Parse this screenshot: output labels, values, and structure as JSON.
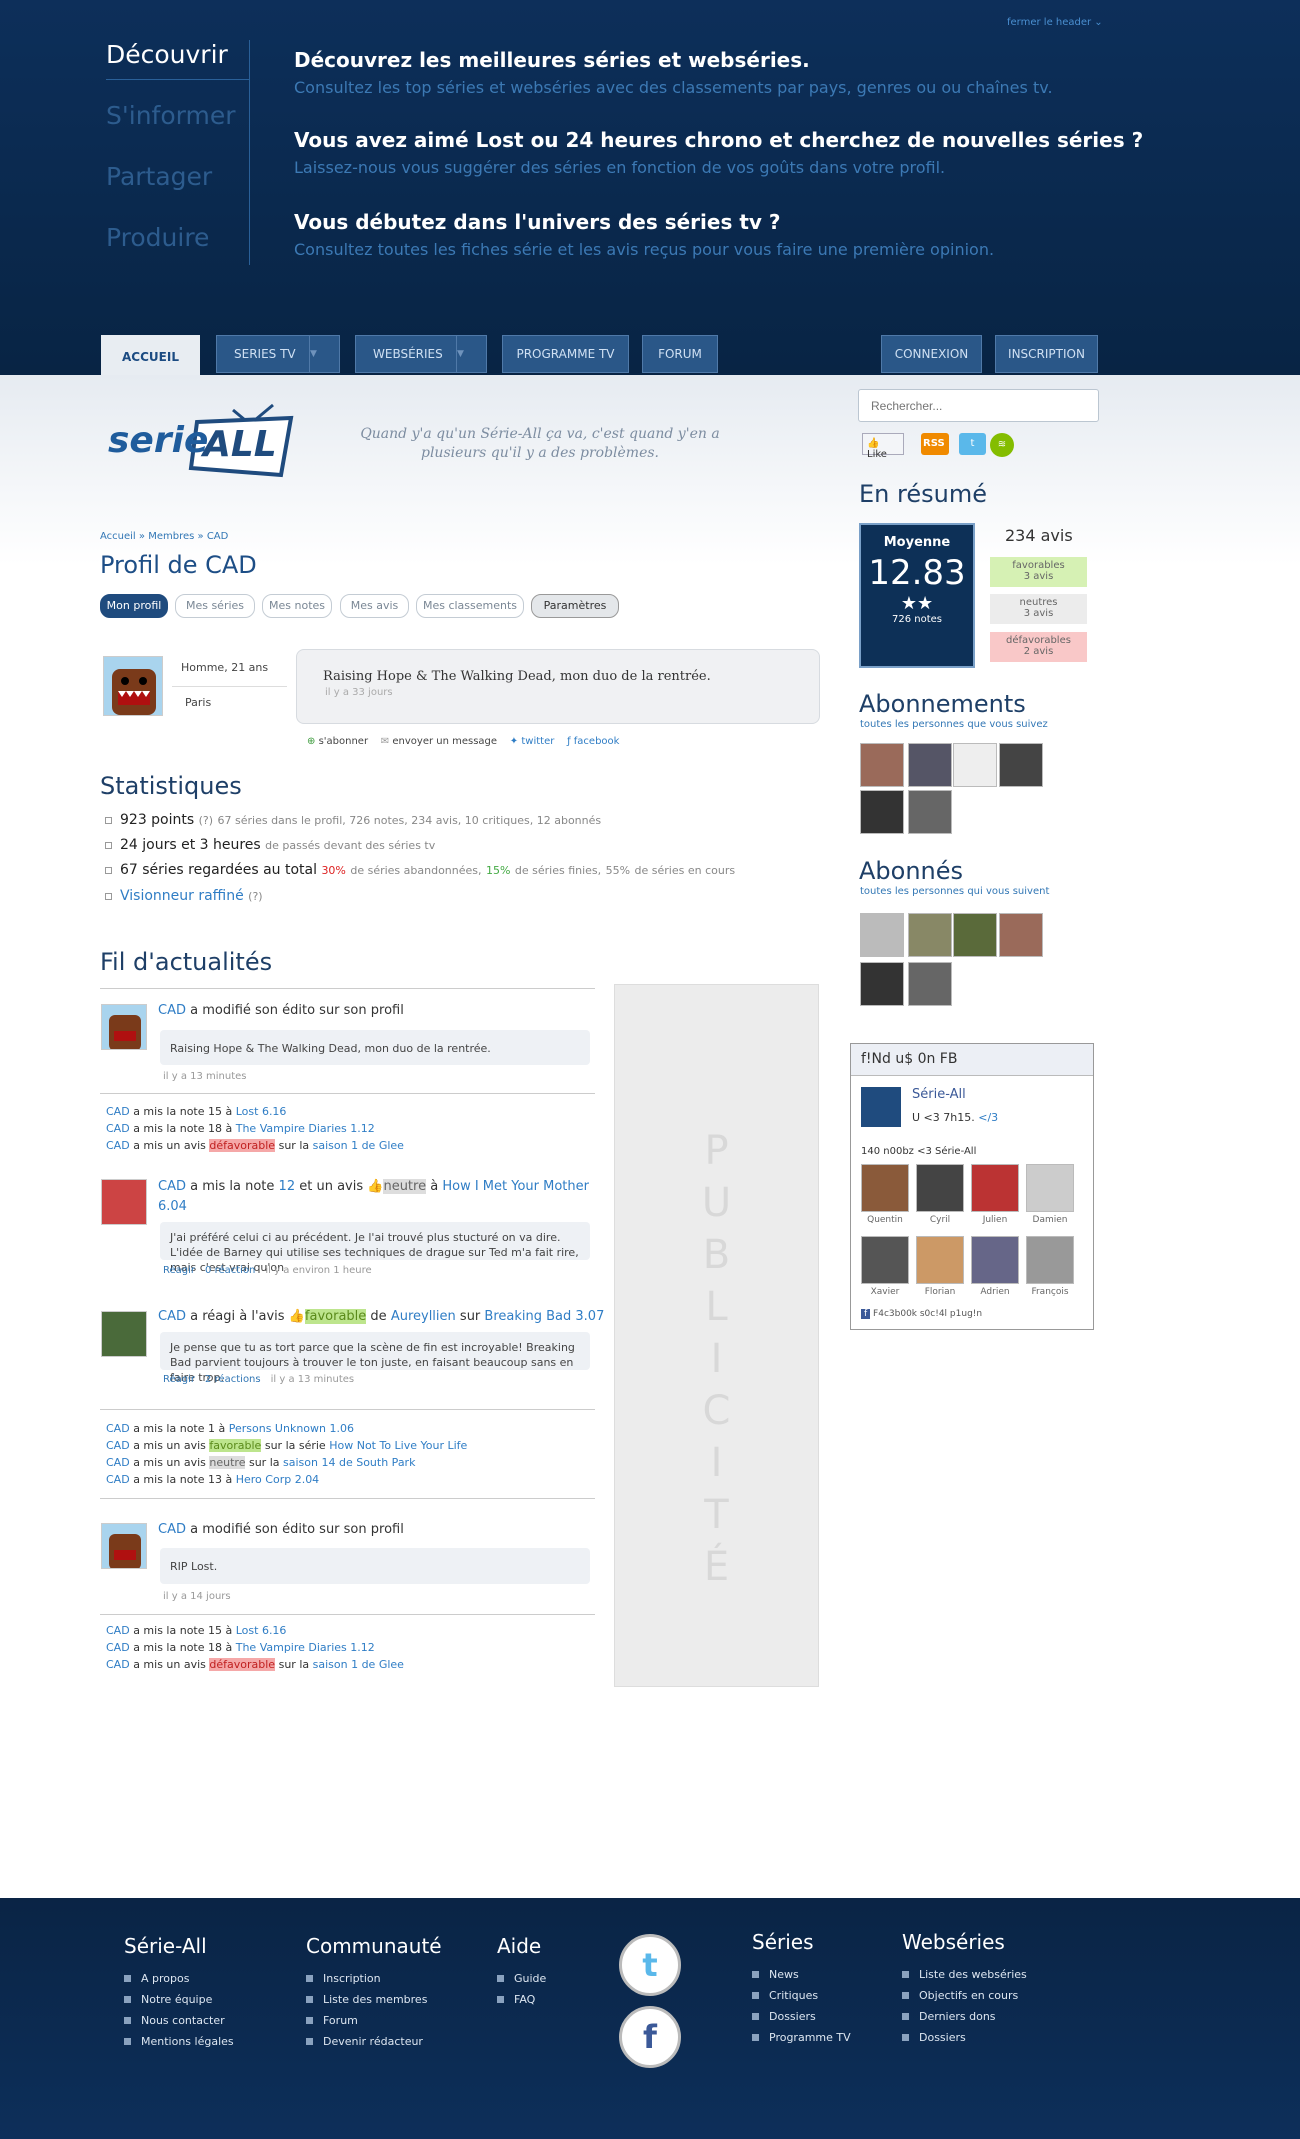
{
  "header": {
    "close": "fermer le header ⌄",
    "nav": [
      "Découvrir",
      "S'informer",
      "Partager",
      "Produire"
    ],
    "blocks": [
      {
        "title": "Découvrez les meilleures séries et webséries.",
        "text": "Consultez les top séries et webséries avec des classements par pays, genres ou ou chaînes tv."
      },
      {
        "title": "Vous avez aimé Lost ou 24 heures chrono et cherchez de nouvelles séries ?",
        "text": "Laissez-nous vous suggérer des séries en fonction de vos goûts dans votre profil."
      },
      {
        "title": "Vous débutez dans l'univers des séries tv ?",
        "text": "Consultez toutes les fiches série et les avis reçus pour vous faire une première opinion."
      }
    ]
  },
  "tabs": {
    "accueil": "ACCUEIL",
    "series": "SERIES TV",
    "webseries": "WEBSÉRIES",
    "programme": "PROGRAMME TV",
    "forum": "FORUM",
    "connexion": "CONNEXION",
    "inscription": "INSCRIPTION"
  },
  "logo": {
    "a": "serie",
    "b": "ALL"
  },
  "quote": "Quand y'a qu'un Série-All ça va, c'est quand y'en a plusieurs qu'il y a des problèmes.",
  "search": {
    "placeholder": "Rechercher..."
  },
  "social": {
    "like": "Like",
    "rss": "RSS"
  },
  "breadcrumb": {
    "a": "Accueil",
    "b": "Membres",
    "c": "CAD"
  },
  "profile": {
    "title": "Profil de CAD",
    "tabs": [
      "Mon profil",
      "Mes séries",
      "Mes notes",
      "Mes avis",
      "Mes classements",
      "Paramètres"
    ],
    "gender": "Homme, 21 ans",
    "city": "Paris",
    "status": "Raising Hope & The Walking Dead, mon duo de la rentrée.",
    "status_time": "il y a 33 jours",
    "actions": [
      "s'abonner",
      "envoyer un message",
      "twitter",
      "facebook"
    ]
  },
  "stats": {
    "title": "Statistiques",
    "l1": "923 points",
    "l1q": "(?)",
    "l1m": "67 séries dans le profil, 726 notes, 234 avis, 10 critiques, 12 abonnés",
    "l2": "24 jours et 3 heures",
    "l2m": "de passés devant des séries tv",
    "l3": "67 séries regardées au total",
    "l3a": "30%",
    "l3b": "de séries abandonnées,",
    "l3c": "15%",
    "l3d": "de séries finies,",
    "l3e": "55%",
    "l3f": "de séries en cours",
    "l4": "Visionneur raffiné",
    "l4q": "(?)"
  },
  "feed": {
    "title": "Fil d'actualités",
    "u": "CAD",
    "e1": {
      "t": "a modifié son édito sur son profil",
      "q": "Raising Hope & The Walking Dead, mon duo de la rentrée.",
      "time": "il y a 13 minutes"
    },
    "a1": [
      [
        "a mis la note 15 à",
        "Lost 6.16"
      ],
      [
        "a mis la note 18 à",
        "The Vampire Diaries 1.12"
      ],
      [
        "a mis un avis",
        "défavorable",
        "sur la",
        "saison 1 de Glee"
      ]
    ],
    "e2": {
      "t1": "a mis la note",
      "n": "12",
      "t2": "et un avis",
      "tag": "neutre",
      "t3": "à",
      "show": "How I Met Your Mother 6.04",
      "q": "J'ai préféré celui ci au précédent. Je l'ai trouvé plus stucturé on va dire. L'idée de Barney qui utilise ses techniques de drague sur Ted m'a fait rire, mais c'est vrai qu'on",
      "r": "Réagir",
      "c": "0 réaction",
      "time": "il y a environ 1 heure"
    },
    "e3": {
      "t1": "a réagi à l'avis",
      "tag": "favorable",
      "t2": "de",
      "who": "Aureyllien",
      "t3": "sur",
      "show": "Breaking Bad 3.07",
      "q": "Je pense que tu as tort parce que la scène de fin est incroyable! Breaking Bad parvient toujours à trouver le ton juste, en faisant beaucoup sans en faire trop.",
      "r": "Réagir",
      "c": "2 réactions",
      "time": "il y a 13 minutes"
    },
    "a2": [
      [
        "a mis la note 1 à",
        "Persons Unknown 1.06"
      ],
      [
        "a mis un avis",
        "favorable",
        "sur la série",
        "How Not To Live Your Life"
      ],
      [
        "a mis un avis",
        "neutre",
        "sur la",
        "saison 14 de South Park"
      ],
      [
        "a mis la note 13 à",
        "Hero Corp 2.04"
      ]
    ],
    "e4": {
      "t": "a modifié son édito sur son profil",
      "q": "RIP Lost.",
      "time": "il y a 14 jours"
    },
    "a3": [
      [
        "a mis la note 15 à",
        "Lost 6.16"
      ],
      [
        "a mis la note 18 à",
        "The Vampire Diaries 1.12"
      ],
      [
        "a mis un avis",
        "défavorable",
        "sur la",
        "saison 1 de Glee"
      ]
    ]
  },
  "pub": "P U B L I C I T É",
  "resume": {
    "title": "En résumé",
    "moy": "Moyenne",
    "note": "12.83",
    "stars": "★★",
    "notes": "726 notes",
    "avis": "234 avis",
    "fav": "favorables",
    "fav_n": "3 avis",
    "neu": "neutres",
    "neu_n": "3 avis",
    "def": "défavorables",
    "def_n": "2 avis"
  },
  "abos": {
    "title": "Abonnements",
    "sub": "toutes les personnes que vous suivez"
  },
  "abonnes": {
    "title": "Abonnés",
    "sub": "toutes les personnes qui vous suivent"
  },
  "fb": {
    "title": "f!Nd u$ 0n FB",
    "page": "Série-All",
    "tag": "U <3 7h15.",
    "tag2": "</3",
    "count": "140 n00bz <3 Série-All",
    "names": [
      "Quentin",
      "Cyril",
      "Julien",
      "Damien",
      "Xavier",
      "Florian",
      "Adrien",
      "François"
    ],
    "plugin": "F4c3b00k s0c!4l p1ug!n"
  },
  "footer": {
    "c1": {
      "t": "Série-All",
      "i": [
        "A propos",
        "Notre équipe",
        "Nous contacter",
        "Mentions légales"
      ]
    },
    "c2": {
      "t": "Communauté",
      "i": [
        "Inscription",
        "Liste des membres",
        "Forum",
        "Devenir rédacteur"
      ]
    },
    "c3": {
      "t": "Aide",
      "i": [
        "Guide",
        "FAQ"
      ]
    },
    "c4": {
      "t": "Séries",
      "i": [
        "News",
        "Critiques",
        "Dossiers",
        "Programme TV"
      ]
    },
    "c5": {
      "t": "Webséries",
      "i": [
        "Liste des webséries",
        "Objectifs en cours",
        "Derniers dons",
        "Dossiers"
      ]
    }
  },
  "colors": {
    "header": "#0d2f5a",
    "accent": "#2f7dc5",
    "red": "#f5a8a8",
    "green": "#bde58d"
  }
}
